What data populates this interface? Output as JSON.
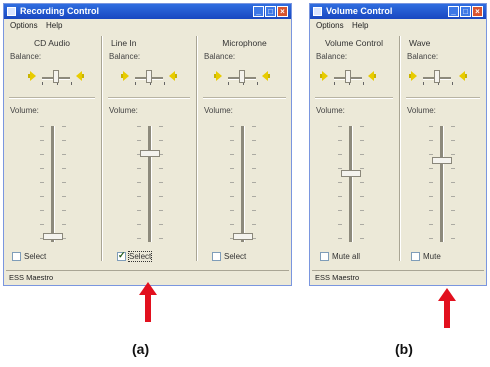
{
  "windows": {
    "recording": {
      "title": "Recording Control",
      "menu": [
        "Options",
        "Help"
      ],
      "panels": [
        {
          "title": "CD Audio",
          "balance_label": "Balance:",
          "volume_label": "Volume:",
          "volume_level": 0.02,
          "select_label": "Select",
          "checked": false
        },
        {
          "title": "Line In",
          "balance_label": "Balance:",
          "volume_label": "Volume:",
          "volume_level": 0.78,
          "select_label": "Select",
          "checked": true
        },
        {
          "title": "Microphone",
          "balance_label": "Balance:",
          "volume_label": "Volume:",
          "volume_level": 0.02,
          "select_label": "Select",
          "checked": false
        }
      ],
      "status": "ESS Maestro"
    },
    "volume": {
      "title": "Volume Control",
      "menu": [
        "Options",
        "Help"
      ],
      "panels": [
        {
          "title": "Volume Control",
          "balance_label": "Balance:",
          "volume_label": "Volume:",
          "volume_level": 0.6,
          "select_label": "Mute all",
          "checked": false
        },
        {
          "title": "Wave",
          "balance_label": "Balance:",
          "volume_label": "Volume:",
          "volume_level": 0.72,
          "select_label": "Mute",
          "checked": false
        }
      ],
      "status": "ESS Maestro"
    }
  },
  "captions": {
    "a": "(a)",
    "b": "(b)"
  },
  "colors": {
    "arrow": "#e2101e",
    "titlebar": "#1f55d0",
    "window_bg": "#ece9d8"
  }
}
